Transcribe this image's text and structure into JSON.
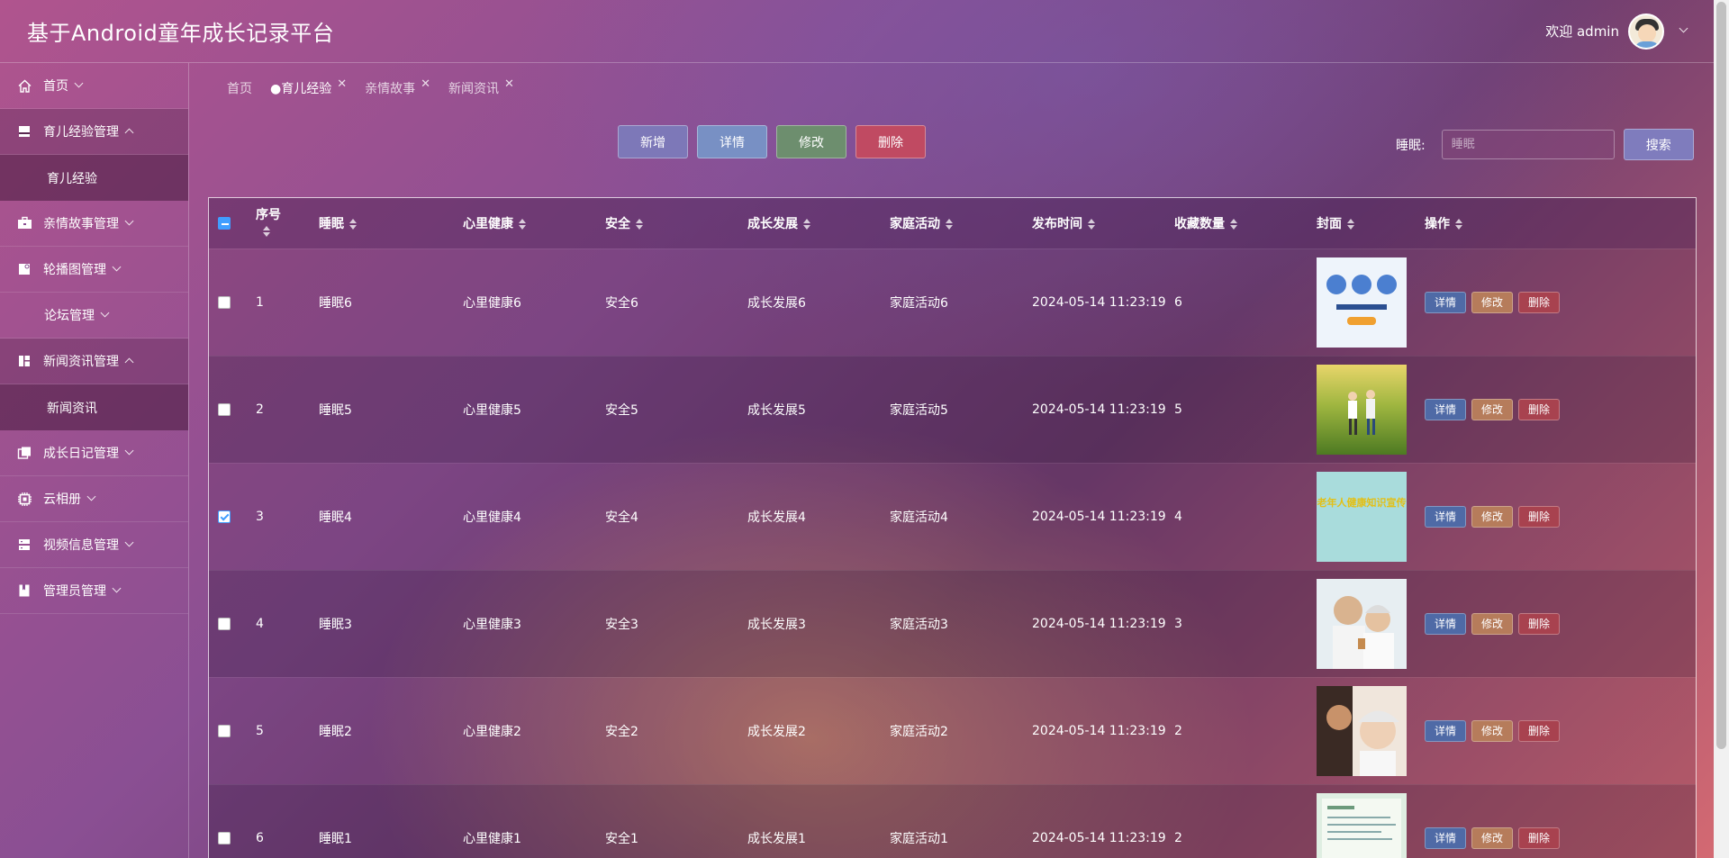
{
  "header": {
    "title": "基于Android童年成长记录平台",
    "welcome": "欢迎 admin"
  },
  "sidebar": {
    "items": [
      {
        "label": "首页",
        "icon": "home-icon"
      },
      {
        "label": "育儿经验管理",
        "icon": "inbox-icon",
        "open": true,
        "children": [
          "育儿经验"
        ]
      },
      {
        "label": "亲情故事管理",
        "icon": "briefcase-icon"
      },
      {
        "label": "轮播图管理",
        "icon": "image-doc-icon"
      },
      {
        "label": "论坛管理",
        "icon": ""
      },
      {
        "label": "新闻资讯管理",
        "icon": "layout-icon",
        "open": true,
        "children": [
          "新闻资讯"
        ]
      },
      {
        "label": "成长日记管理",
        "icon": "copy-icon"
      },
      {
        "label": "云相册",
        "icon": "chip-icon"
      },
      {
        "label": "视频信息管理",
        "icon": "server-icon"
      },
      {
        "label": "管理员管理",
        "icon": "book-icon"
      }
    ]
  },
  "tabs": [
    {
      "label": "首页",
      "closable": false
    },
    {
      "label": "●育儿经验",
      "closable": true,
      "active": true
    },
    {
      "label": "亲情故事",
      "closable": true
    },
    {
      "label": "新闻资讯",
      "closable": true
    }
  ],
  "toolbar": {
    "add": "新增",
    "detail": "详情",
    "edit": "修改",
    "delete": "删除"
  },
  "search": {
    "label": "睡眠:",
    "placeholder": "睡眠",
    "button": "搜索"
  },
  "table": {
    "columns": [
      "序号",
      "睡眠",
      "心里健康",
      "安全",
      "成长发展",
      "家庭活动",
      "发布时间",
      "收藏数量",
      "封面",
      "操作"
    ],
    "rows": [
      {
        "index": "1",
        "sleep": "睡眠6",
        "mental": "心里健康6",
        "safety": "安全6",
        "growth": "成长发展6",
        "family": "家庭活动6",
        "time": "2024-05-14 11:23:19",
        "favorites": "6",
        "checked": false,
        "cover": "promo-poster"
      },
      {
        "index": "2",
        "sleep": "睡眠5",
        "mental": "心里健康5",
        "safety": "安全5",
        "growth": "成长发展5",
        "family": "家庭活动5",
        "time": "2024-05-14 11:23:19",
        "favorites": "5",
        "checked": false,
        "cover": "elderly-running"
      },
      {
        "index": "3",
        "sleep": "睡眠4",
        "mental": "心里健康4",
        "safety": "安全4",
        "growth": "成长发展4",
        "family": "家庭活动4",
        "time": "2024-05-14 11:23:19",
        "favorites": "4",
        "checked": true,
        "cover": "health-poster",
        "cover_text": "老年人健康知识宣传"
      },
      {
        "index": "4",
        "sleep": "睡眠3",
        "mental": "心里健康3",
        "safety": "安全3",
        "growth": "成长发展3",
        "family": "家庭活动3",
        "time": "2024-05-14 11:23:19",
        "favorites": "3",
        "checked": false,
        "cover": "elderly-couple"
      },
      {
        "index": "5",
        "sleep": "睡眠2",
        "mental": "心里健康2",
        "safety": "安全2",
        "growth": "成长发展2",
        "family": "家庭活动2",
        "time": "2024-05-14 11:23:19",
        "favorites": "2",
        "checked": false,
        "cover": "hearing-check"
      },
      {
        "index": "6",
        "sleep": "睡眠1",
        "mental": "心里健康1",
        "safety": "安全1",
        "growth": "成长发展1",
        "family": "家庭活动1",
        "time": "2024-05-14 11:23:19",
        "favorites": "2",
        "checked": false,
        "cover": "document"
      }
    ],
    "ops": {
      "detail": "详情",
      "edit": "修改",
      "delete": "删除"
    }
  },
  "colors": {
    "add": "#7d78b8",
    "detail": "#7890c4",
    "edit": "#6d8e6e",
    "delete": "#c04a62",
    "op_detail": "#4f6aa6",
    "op_edit": "#b67c5b",
    "op_delete": "#a8424f"
  }
}
